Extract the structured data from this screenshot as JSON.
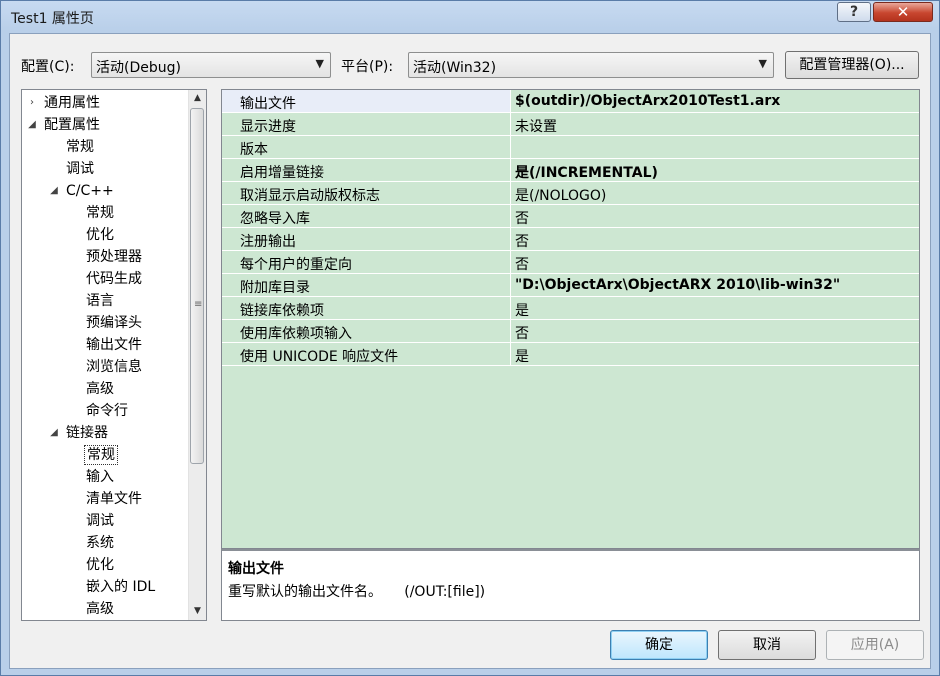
{
  "window": {
    "title": "Test1 属性页",
    "help_label": "?",
    "close_label": "✕"
  },
  "toolbar": {
    "config_label": "配置(C):",
    "config_value": "活动(Debug)",
    "platform_label": "平台(P):",
    "platform_value": "活动(Win32)",
    "config_manager_label": "配置管理器(O)..."
  },
  "tree": {
    "items": [
      {
        "label": "通用属性",
        "toggle": "›"
      },
      {
        "label": "配置属性",
        "toggle": "◢"
      },
      {
        "label": "常规"
      },
      {
        "label": "调试"
      },
      {
        "label": "C/C++",
        "toggle": "◢"
      },
      {
        "label": "常规"
      },
      {
        "label": "优化"
      },
      {
        "label": "预处理器"
      },
      {
        "label": "代码生成"
      },
      {
        "label": "语言"
      },
      {
        "label": "预编译头"
      },
      {
        "label": "输出文件"
      },
      {
        "label": "浏览信息"
      },
      {
        "label": "高级"
      },
      {
        "label": "命令行"
      },
      {
        "label": "链接器",
        "toggle": "◢"
      },
      {
        "label": "常规",
        "selected": true
      },
      {
        "label": "输入"
      },
      {
        "label": "清单文件"
      },
      {
        "label": "调试"
      },
      {
        "label": "系统"
      },
      {
        "label": "优化"
      },
      {
        "label": "嵌入的 IDL"
      },
      {
        "label": "高级"
      }
    ],
    "scroll_up": "▲",
    "scroll_down": "▼",
    "grip": "≡"
  },
  "grid": {
    "rows": [
      {
        "name": "输出文件",
        "value": "$(outdir)/ObjectArx2010Test1.arx",
        "bold": true,
        "selected": true
      },
      {
        "name": "显示进度",
        "value": "未设置",
        "bold": false
      },
      {
        "name": "版本",
        "value": "",
        "bold": false
      },
      {
        "name": "启用增量链接",
        "value": "是(/INCREMENTAL)",
        "bold": true
      },
      {
        "name": "取消显示启动版权标志",
        "value": "是(/NOLOGO)",
        "bold": false
      },
      {
        "name": "忽略导入库",
        "value": "否",
        "bold": false
      },
      {
        "name": "注册输出",
        "value": "否",
        "bold": false
      },
      {
        "name": "每个用户的重定向",
        "value": "否",
        "bold": false
      },
      {
        "name": "附加库目录",
        "value": "\"D:\\ObjectArx\\ObjectARX 2010\\lib-win32\"",
        "bold": true
      },
      {
        "name": "链接库依赖项",
        "value": "是",
        "bold": false
      },
      {
        "name": "使用库依赖项输入",
        "value": "否",
        "bold": false
      },
      {
        "name": "使用 UNICODE 响应文件",
        "value": "是",
        "bold": false
      }
    ]
  },
  "description": {
    "title": "输出文件",
    "text": "重写默认的输出文件名。     (/OUT:[file])"
  },
  "buttons": {
    "ok": "确定",
    "cancel": "取消",
    "apply": "应用(A)"
  },
  "colors": {
    "grid_background": "#cde7d2",
    "title_bar": "#b9cfe9",
    "close_button": "#c8462f"
  }
}
